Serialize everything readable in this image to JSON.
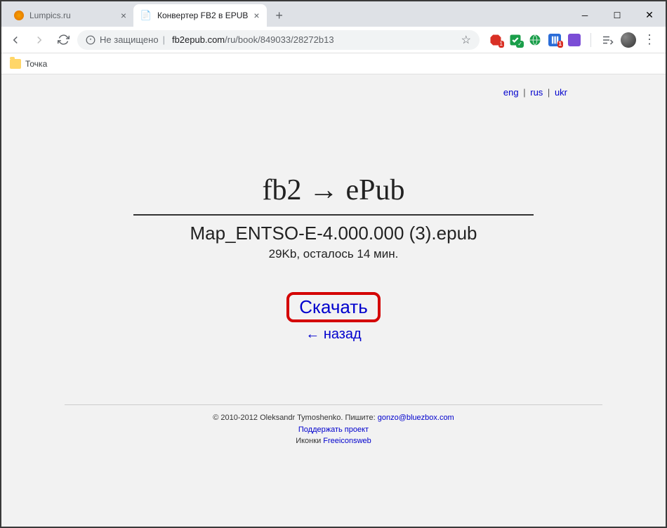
{
  "window": {
    "tabs": [
      {
        "title": "Lumpics.ru",
        "favicon": "orange"
      },
      {
        "title": "Конвертер FB2 в EPUB",
        "favicon": "page"
      }
    ]
  },
  "toolbar": {
    "security_label": "Не защищено",
    "url_host": "fb2epub.com",
    "url_path": "/ru/book/849033/28272b13"
  },
  "bookmarks": {
    "item1": "Точка"
  },
  "lang": {
    "eng": "eng",
    "rus": "rus",
    "ukr": "ukr"
  },
  "page": {
    "title": "fb2 → ePub",
    "filename": "Map_ENTSO-E-4.000.000 (3).epub",
    "fileinfo": "29Kb, осталось 14 мин.",
    "download": "Скачать",
    "back": "← назад"
  },
  "footer": {
    "copyright": "© 2010-2012 Oleksandr Tymoshenko. Пишите: ",
    "email": "gonzo@bluezbox.com",
    "support": "Поддержать проект",
    "icons_label": "Иконки ",
    "icons_link": "Freeiconsweb"
  }
}
